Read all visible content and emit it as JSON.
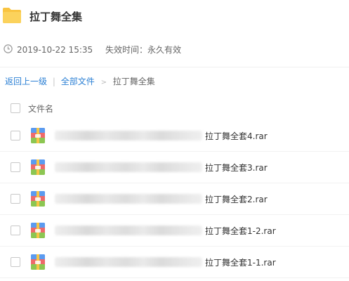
{
  "header": {
    "title": "拉丁舞全集"
  },
  "meta": {
    "timestamp": "2019-10-22 15:35",
    "expire": "失效时间：永久有效"
  },
  "breadcrumb": {
    "back": "返回上一级",
    "separator": "|",
    "all_files": "全部文件",
    "arrow": ">",
    "current": "拉丁舞全集"
  },
  "list": {
    "column_name": "文件名",
    "files": [
      {
        "name": "拉丁舞全套4.rar"
      },
      {
        "name": "拉丁舞全套3.rar"
      },
      {
        "name": "拉丁舞全套2.rar"
      },
      {
        "name": "拉丁舞全套1-2.rar"
      },
      {
        "name": "拉丁舞全套1-1.rar"
      }
    ]
  },
  "colors": {
    "link": "#2a7fd4",
    "folder": "#f9c441"
  },
  "icons": {
    "folder": "folder-icon",
    "clock": "clock-icon",
    "file": "rar-archive-icon",
    "checkbox": "checkbox"
  }
}
